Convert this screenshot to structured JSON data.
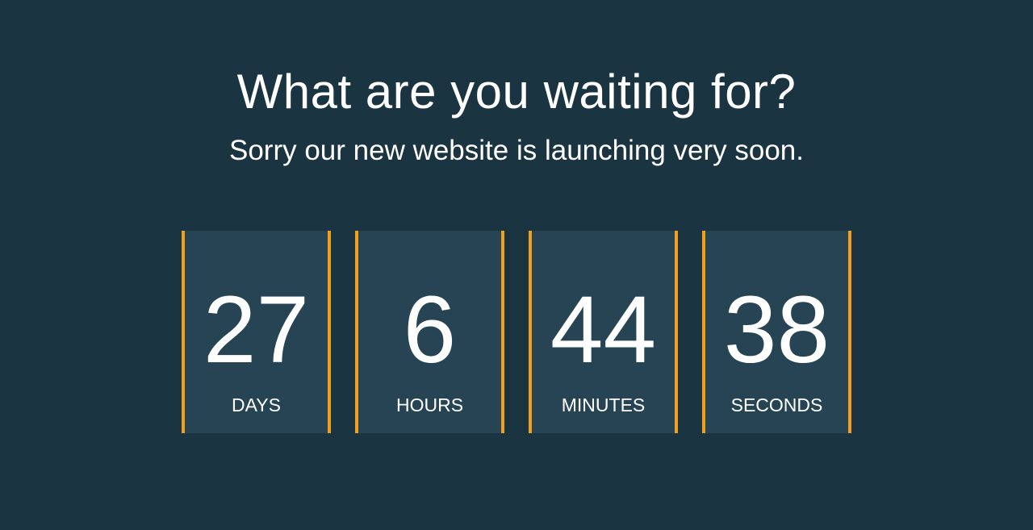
{
  "page": {
    "headline": "What are you waiting for?",
    "subline": "Sorry our new website is launching very soon."
  },
  "countdown": {
    "units": [
      {
        "value": "27",
        "label": "DAYS"
      },
      {
        "value": "6",
        "label": "HOURS"
      },
      {
        "value": "44",
        "label": "MINUTES"
      },
      {
        "value": "38",
        "label": "SECONDS"
      }
    ]
  },
  "colors": {
    "background": "#1b3442",
    "card": "#264453",
    "accent": "#f29f1c",
    "text": "#ffffff"
  }
}
